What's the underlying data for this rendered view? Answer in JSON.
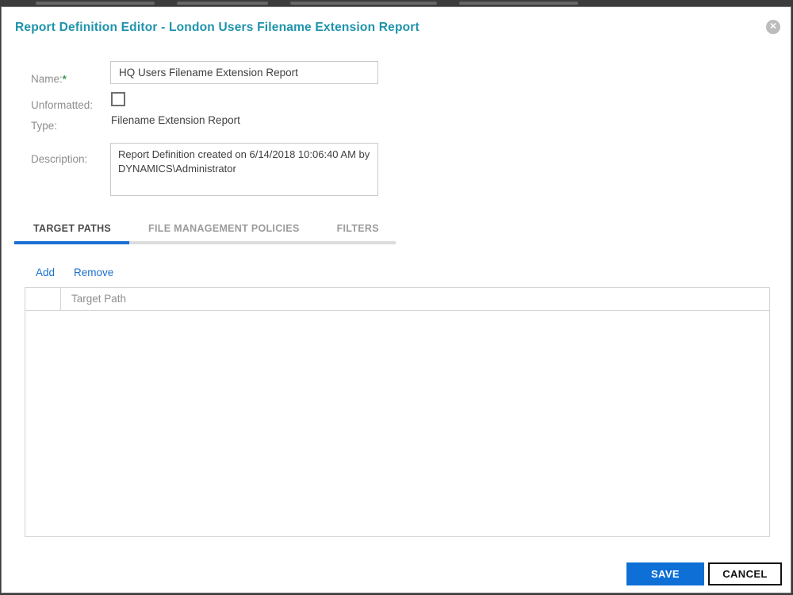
{
  "dialog": {
    "title": "Report Definition Editor - London Users Filename Extension Report",
    "close_glyph": "✕"
  },
  "form": {
    "name": {
      "label": "Name:",
      "required_marker": "*",
      "value": "HQ Users Filename Extension Report"
    },
    "unformatted": {
      "label": "Unformatted:",
      "checked": false
    },
    "type": {
      "label": "Type:",
      "value": "Filename Extension Report"
    },
    "description": {
      "label": "Description:",
      "value": "Report Definition created on 6/14/2018 10:06:40 AM by DYNAMICS\\Administrator"
    }
  },
  "tabs": [
    {
      "label": "TARGET PATHS",
      "active": true
    },
    {
      "label": "FILE MANAGEMENT POLICIES",
      "active": false
    },
    {
      "label": "FILTERS",
      "active": false
    }
  ],
  "list_toolbar": {
    "add_label": "Add",
    "remove_label": "Remove"
  },
  "table": {
    "columns": [
      "",
      "Target Path"
    ],
    "rows": []
  },
  "footer": {
    "save_label": "SAVE",
    "cancel_label": "CANCEL"
  },
  "colors": {
    "title_teal": "#1e93ab",
    "accent_blue": "#0e6fd6",
    "tab_indicator_blue": "#1b6fd2",
    "link_blue": "#1b6fc8",
    "required_green": "#2e9a44"
  }
}
